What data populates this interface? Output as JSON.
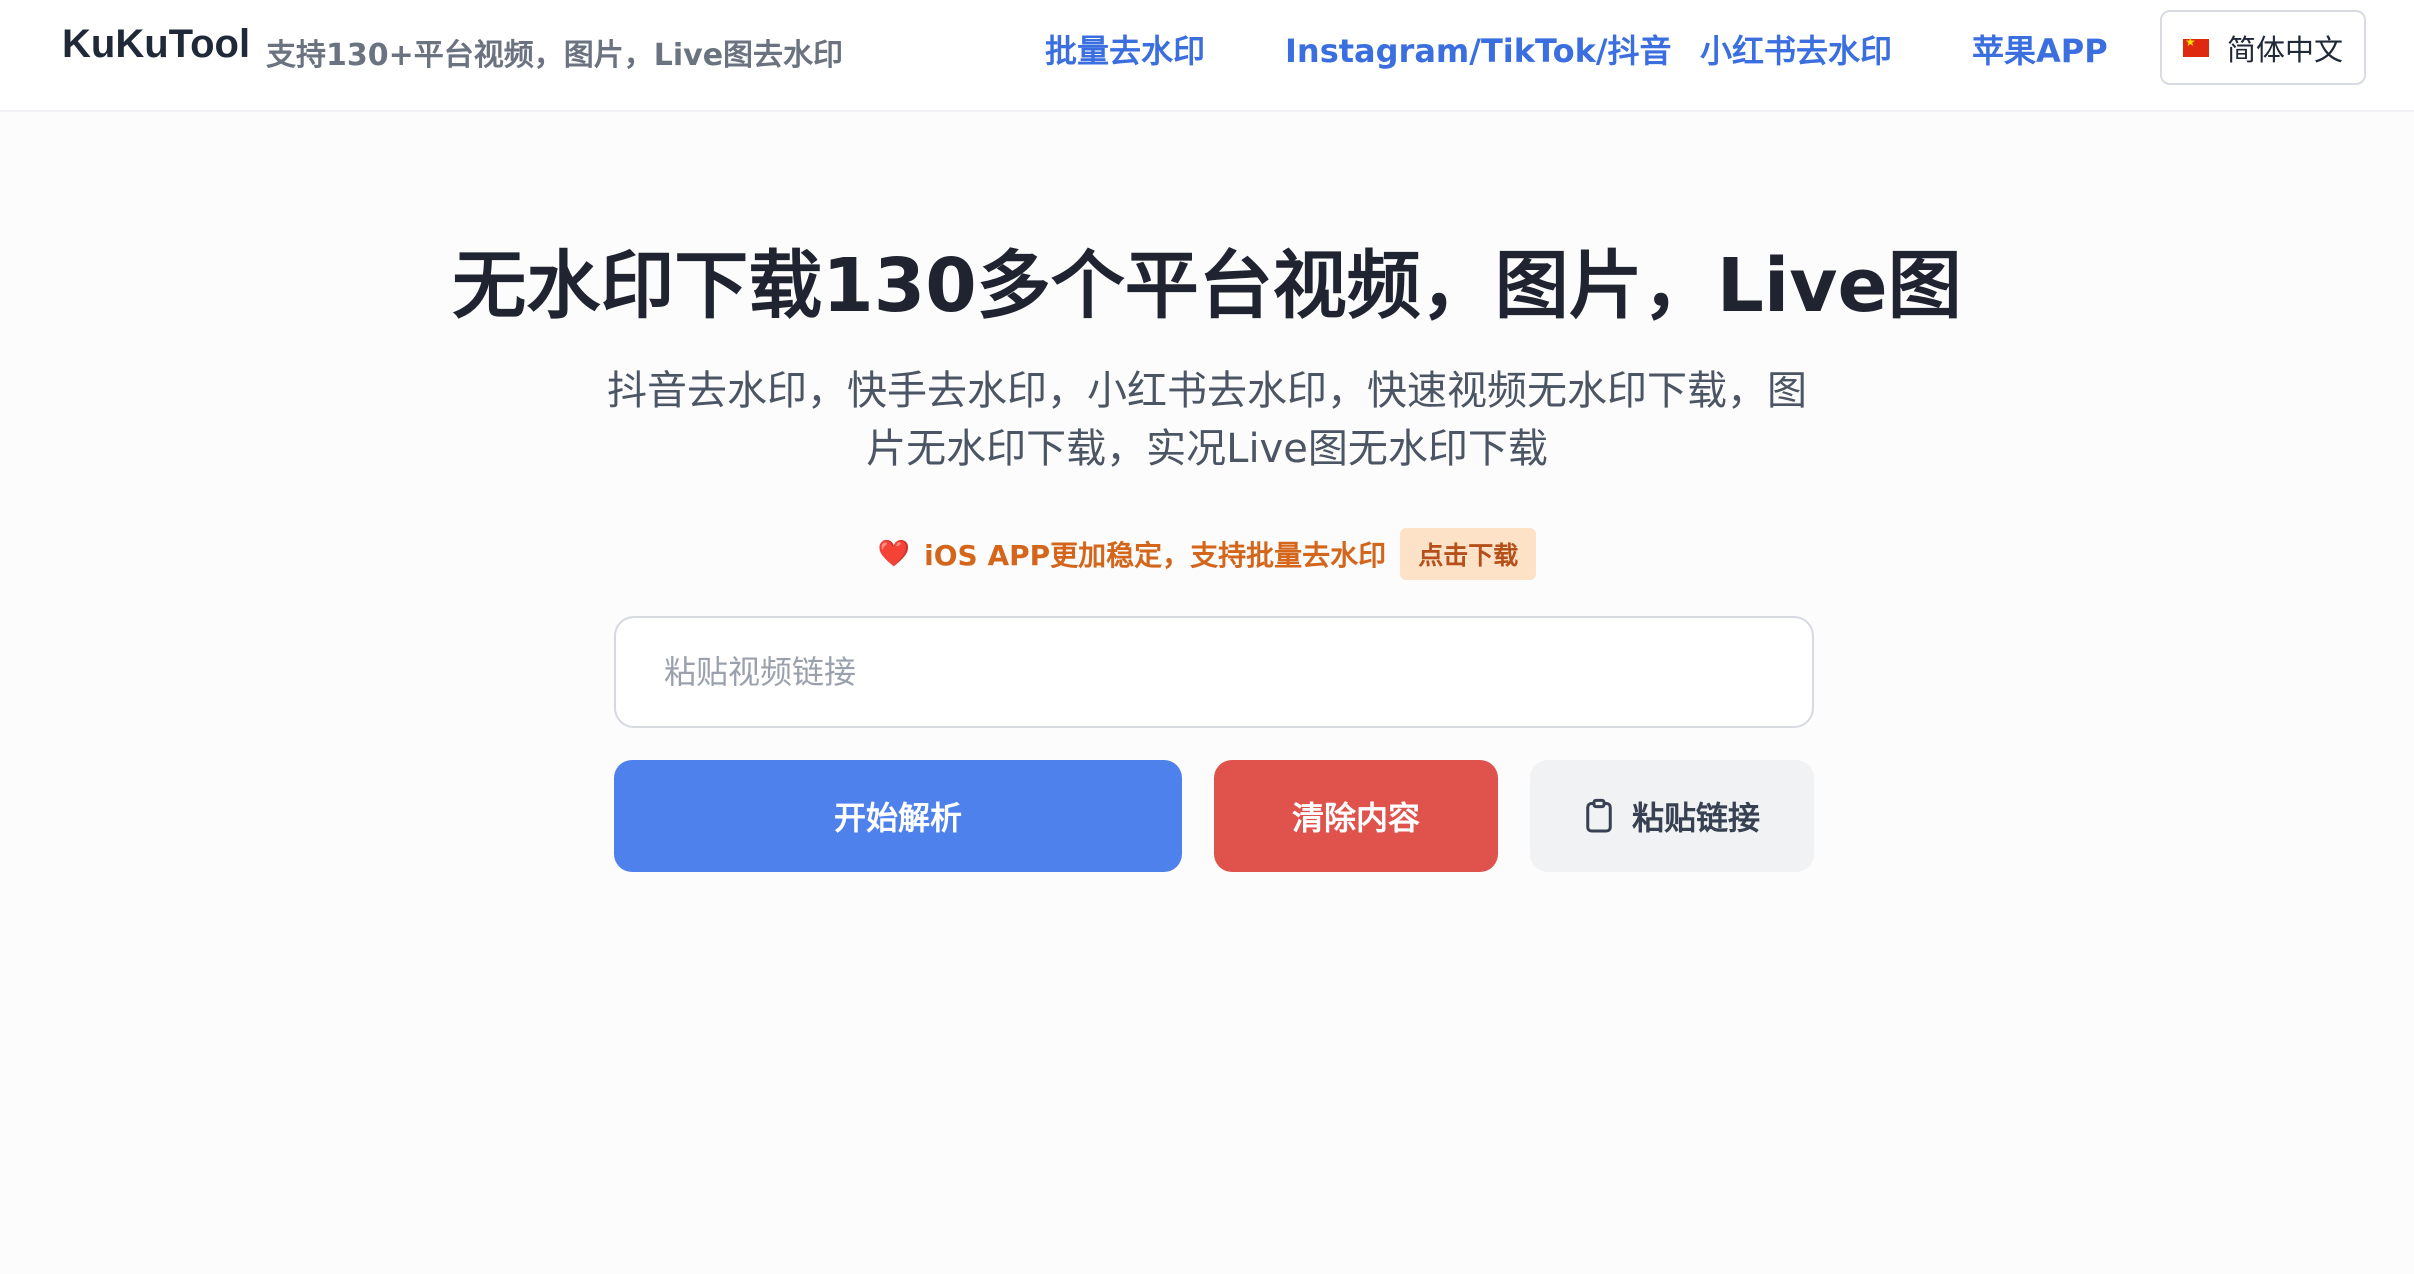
{
  "header": {
    "brand": "KuKuTool",
    "tagline": "支持130+平台视频，图片，Live图去水印",
    "nav": [
      {
        "label": "批量去水印"
      },
      {
        "label": "Instagram/TikTok/抖音"
      },
      {
        "label": "小红书去水印"
      },
      {
        "label": "苹果APP"
      }
    ],
    "language": {
      "label": "简体中文",
      "flag_icon": "china-flag-icon"
    }
  },
  "hero": {
    "title": "无水印下载130多个平台视频，图片，Live图",
    "subtitle": "抖音去水印，快手去水印，小红书去水印，快速视频无水印下载，图片无水印下载，实况Live图无水印下载"
  },
  "promo": {
    "heart": "❤️",
    "text": "iOS APP更加稳定，支持批量去水印",
    "badge": "点击下载"
  },
  "input": {
    "value": "",
    "placeholder": "粘贴视频链接"
  },
  "actions": {
    "parse_label": "开始解析",
    "clear_label": "清除内容",
    "paste_label": "粘贴链接",
    "paste_icon": "clipboard-icon"
  },
  "colors": {
    "nav_link": "#3b6fe0",
    "primary": "#4f81ec",
    "danger": "#e0524c",
    "promo_text": "#d4661c",
    "promo_badge_bg": "#fde2c7"
  }
}
